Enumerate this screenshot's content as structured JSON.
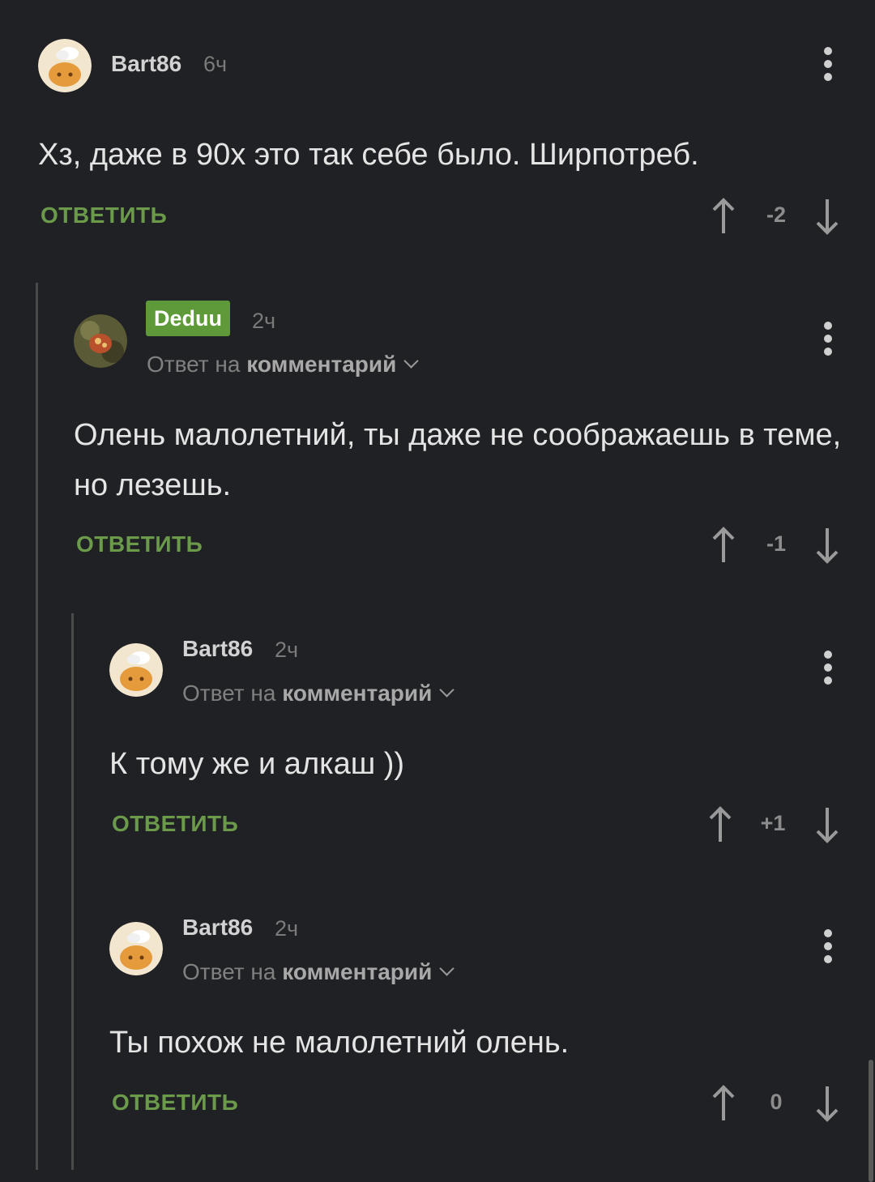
{
  "comments": [
    {
      "username": "Bart86",
      "time": "6ч",
      "reply_prefix": "",
      "reply_target": "",
      "text": "Хз, даже в 90х это так себе было. Ширпотреб.",
      "reply_label": "ОТВЕТИТЬ",
      "score": "-2"
    },
    {
      "username": "Deduu",
      "time": "2ч",
      "reply_prefix": "Ответ на",
      "reply_target": "комментарий",
      "text": "Олень малолетний, ты даже не соображаешь в теме, но лезешь.",
      "reply_label": "ОТВЕТИТЬ",
      "score": "-1"
    },
    {
      "username": "Bart86",
      "time": "2ч",
      "reply_prefix": "Ответ на",
      "reply_target": "комментарий",
      "text": "К тому же и алкаш ))",
      "reply_label": "ОТВЕТИТЬ",
      "score": "+1"
    },
    {
      "username": "Bart86",
      "time": "2ч",
      "reply_prefix": "Ответ на",
      "reply_target": "комментарий",
      "text": "Ты похож не малолетний олень.",
      "reply_label": "ОТВЕТИТЬ",
      "score": "0"
    }
  ],
  "icons": {
    "upvote": "arrow-up-icon",
    "downvote": "arrow-down-icon",
    "menu": "more-vertical-icon",
    "expand": "chevron-down-icon"
  },
  "colors": {
    "background": "#202124",
    "accent_green": "#6a9a4a",
    "badge_green": "#5f9a3a",
    "thread_line": "#4a4a4a"
  }
}
